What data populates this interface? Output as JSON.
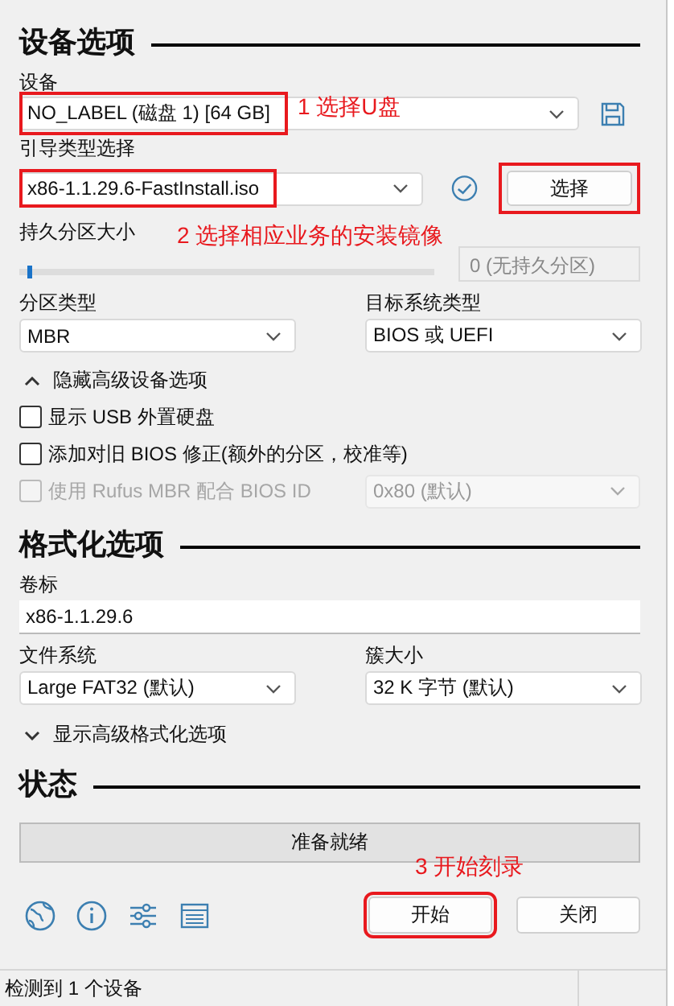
{
  "device_options": {
    "title": "设备选项",
    "device": {
      "label": "设备",
      "value": "NO_LABEL (磁盘 1) [64 GB]",
      "highlighted": true
    },
    "boot": {
      "label": "引导类型选择",
      "value": "x86-1.1.29.6-FastInstall.iso",
      "highlighted": true,
      "button": {
        "label": "选择",
        "highlighted": true
      }
    },
    "persistent": {
      "label": "持久分区大小",
      "level": 0.02,
      "reading": "0 (无持久分区)"
    },
    "partition_scheme": {
      "label": "分区类型",
      "value": "MBR"
    },
    "target_system": {
      "label": "目标系统类型",
      "value": "BIOS 或 UEFI"
    },
    "advanced_toggle": {
      "label": "隐藏高级设备选项",
      "expanded": true
    },
    "checkboxes": [
      {
        "label": "显示 USB 外置硬盘",
        "checked": false,
        "disabled": false
      },
      {
        "label": "添加对旧 BIOS 修正(额外的分区，校准等)",
        "checked": false,
        "disabled": false
      },
      {
        "label": "使用 Rufus MBR 配合 BIOS ID",
        "checked": false,
        "disabled": true
      }
    ],
    "bios_id": {
      "value": "0x80 (默认)",
      "disabled": true
    }
  },
  "format_options": {
    "title": "格式化选项",
    "volume_label": {
      "label": "卷标",
      "value": "x86-1.1.29.6"
    },
    "file_system": {
      "label": "文件系统",
      "value": "Large FAT32 (默认)"
    },
    "cluster_size": {
      "label": "簇大小",
      "value": "32 K 字节 (默认)"
    },
    "advanced_toggle": {
      "label": "显示高级格式化选项",
      "expanded": false
    }
  },
  "status": {
    "title": "状态",
    "progress_text": "准备就绪"
  },
  "buttons": [
    {
      "label": "开始",
      "highlighted": true
    },
    {
      "label": "关闭",
      "highlighted": false
    }
  ],
  "annotations": [
    {
      "text": "1 选择U盘"
    },
    {
      "text": "2 选择相应业务的安装镜像"
    },
    {
      "text": "3 开始刻录"
    }
  ],
  "status_bar": "检测到 1 个设备"
}
